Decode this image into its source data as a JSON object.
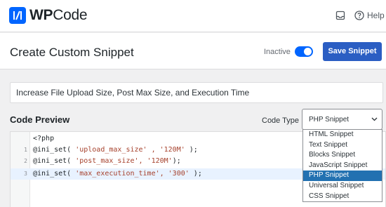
{
  "brand": {
    "name_bold": "WP",
    "name_rest": "Code",
    "accent": "#0065ff"
  },
  "topbar": {
    "help_label": "Help"
  },
  "header": {
    "title": "Create Custom Snippet",
    "status_label": "Inactive",
    "active": true,
    "save_label": "Save Snippet",
    "save_color": "#2b5ec3"
  },
  "snippet_title": {
    "value": "Increase File Upload Size, Post Max Size, and Execution Time"
  },
  "code_section": {
    "label": "Code Preview",
    "type_label": "Code Type",
    "selected_type": "PHP Snippet",
    "lines": [
      {
        "num": "",
        "text": "<?php"
      },
      {
        "num": "1",
        "fn": "@ini_set(",
        "args": [
          " 'upload_max_size' , '120M' ",
          ");"
        ]
      },
      {
        "num": "2",
        "fn": "@ini_set(",
        "args": [
          " 'post_max_size', '120M'",
          ");"
        ]
      },
      {
        "num": "3",
        "fn": "@ini_set(",
        "args": [
          " 'max_execution_time', '300' ",
          ");"
        ]
      }
    ],
    "options": [
      "HTML Snippet",
      "Text Snippet",
      "Blocks Snippet",
      "JavaScript Snippet",
      "PHP Snippet",
      "Universal Snippet",
      "CSS Snippet"
    ]
  }
}
